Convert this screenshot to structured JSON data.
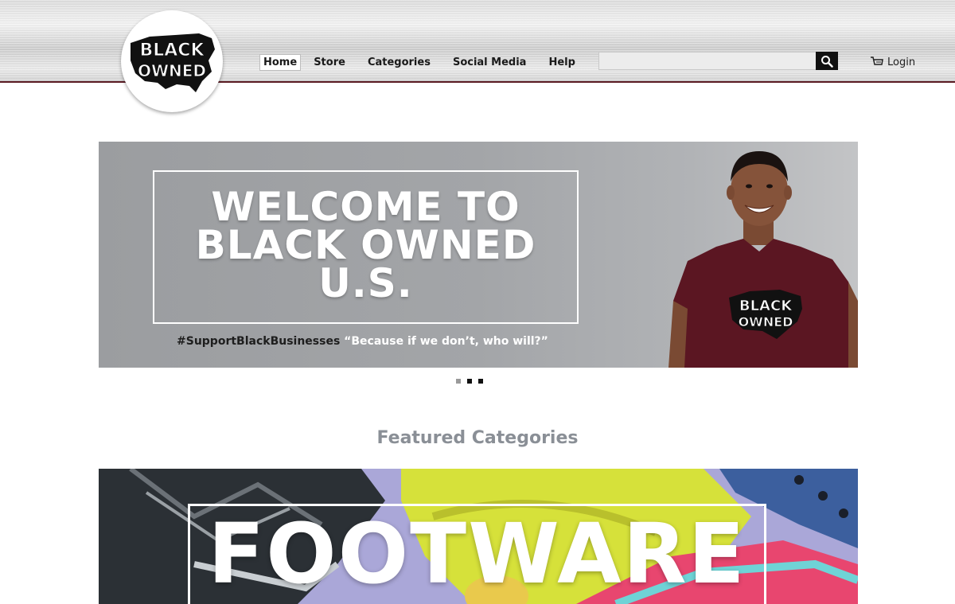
{
  "brand": {
    "logo_text_line1": "BLACK",
    "logo_text_line2": "OWNED"
  },
  "nav": {
    "items": [
      {
        "label": "Home",
        "active": true
      },
      {
        "label": "Store"
      },
      {
        "label": "Categories"
      },
      {
        "label": "Social Media"
      },
      {
        "label": "Help"
      }
    ]
  },
  "search": {
    "value": "",
    "placeholder": "",
    "icon": "search-icon"
  },
  "account": {
    "login_label": "Login",
    "icon": "cart-icon"
  },
  "hero": {
    "title_line1": "WELCOME TO",
    "title_line2": "BLACK OWNED",
    "title_line3": "U.S.",
    "hashtag": "#SupportBlackBusinesses",
    "quote": "“Because if we don’t, who will?”",
    "shirt_logo_line1": "BLACK",
    "shirt_logo_line2": "OWNED"
  },
  "carousel": {
    "slides": 3,
    "active_index": 1
  },
  "featured": {
    "heading": "Featured Categories",
    "first_category": "FOOTWARE"
  },
  "colors": {
    "accent": "#5a1a22",
    "shirt": "#5b1622",
    "hero_bg": "#a3a5a8",
    "featured_heading": "#8a8f96"
  }
}
